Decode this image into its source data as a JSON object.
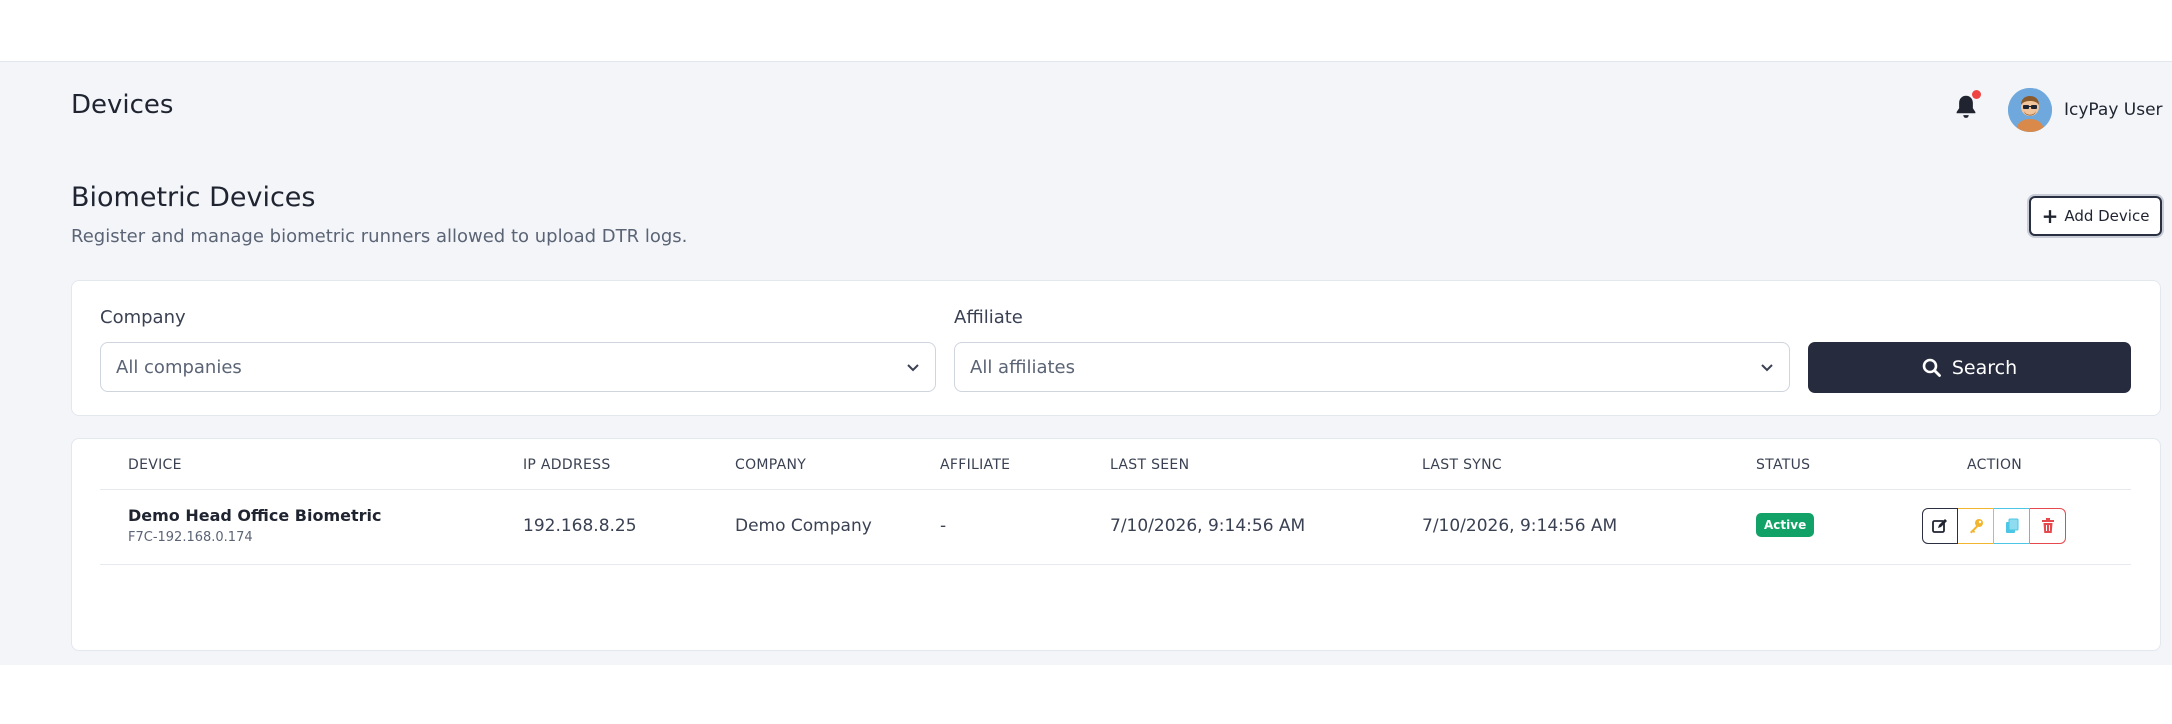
{
  "header": {
    "page_title": "Devices",
    "user_name": "IcyPay User"
  },
  "section": {
    "title": "Biometric Devices",
    "subtitle": "Register and manage biometric runners allowed to upload DTR logs.",
    "add_button_label": "Add Device"
  },
  "filters": {
    "company_label": "Company",
    "company_value": "All companies",
    "affiliate_label": "Affiliate",
    "affiliate_value": "All affiliates",
    "search_label": "Search"
  },
  "table": {
    "columns": [
      "DEVICE",
      "IP ADDRESS",
      "COMPANY",
      "AFFILIATE",
      "LAST SEEN",
      "LAST SYNC",
      "STATUS",
      "ACTION"
    ],
    "rows": [
      {
        "device_name": "Demo Head Office Biometric",
        "device_code": "F7C-192.168.0.174",
        "ip_address": "192.168.8.25",
        "company": "Demo Company",
        "affiliate": "-",
        "last_seen": "7/10/2026, 9:14:56 AM",
        "last_sync": "7/10/2026, 9:14:56 AM",
        "status": "Active"
      }
    ]
  },
  "colors": {
    "accent_dark": "#262b3d",
    "status_active": "#12a166",
    "notification_dot": "#ef4444",
    "key_action": "#f2b530",
    "copy_action": "#4cc6e5",
    "delete_action": "#e5484d"
  },
  "icons": {
    "notification": "bell-icon",
    "add": "plus-icon",
    "search": "search-icon",
    "dropdown": "chevron-down-icon",
    "edit": "edit-icon",
    "key": "key-icon",
    "copy": "copy-icon",
    "delete": "trash-icon"
  }
}
